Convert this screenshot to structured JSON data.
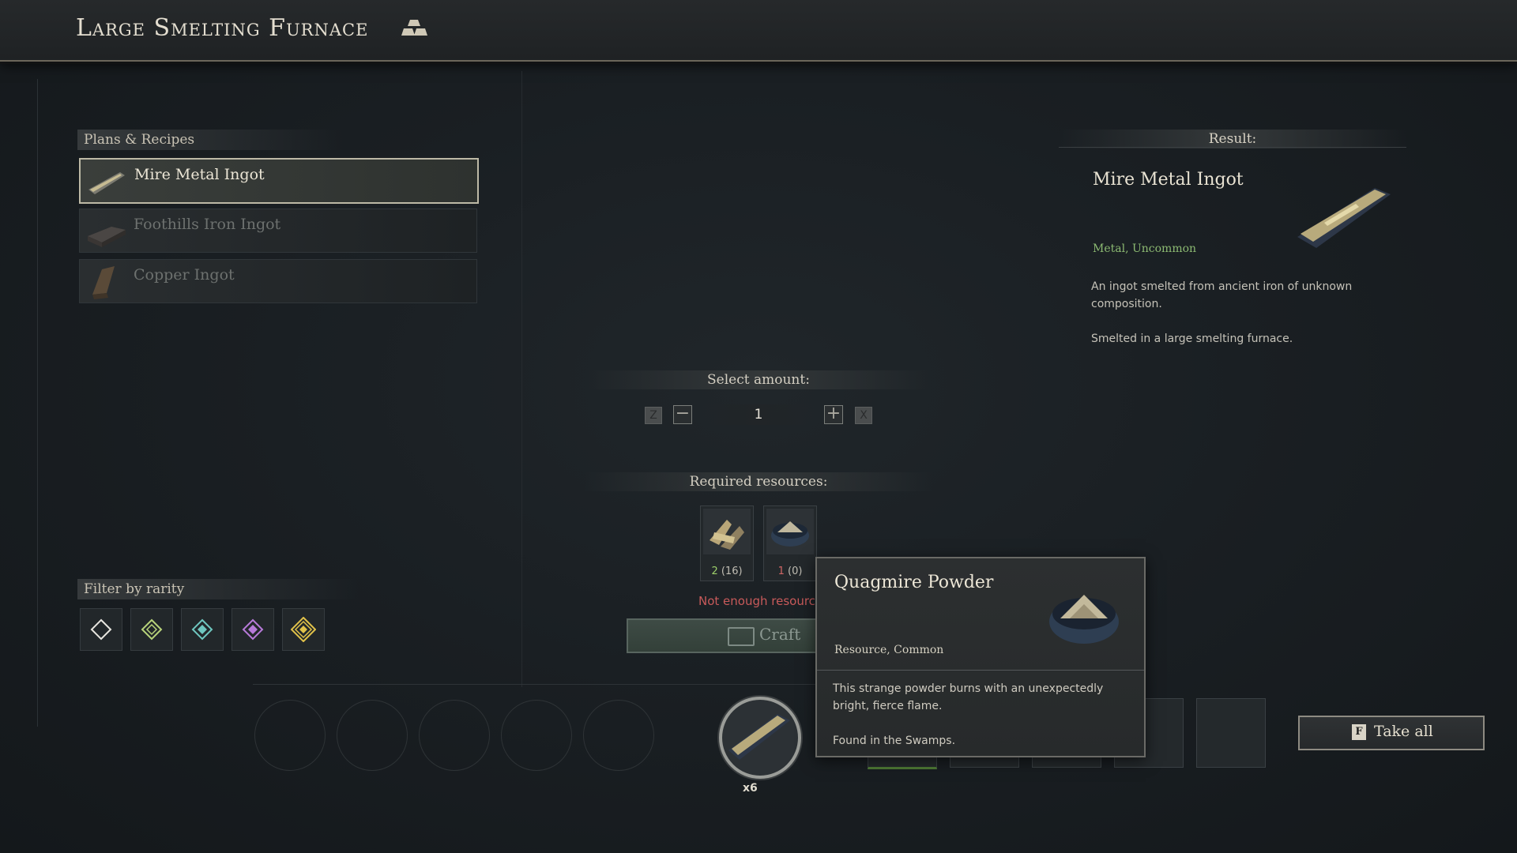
{
  "header": {
    "title": "Large Smelting Furnace",
    "icon": "ingot-stack-icon"
  },
  "recipes": {
    "label": "Plans & Recipes",
    "items": [
      {
        "label": "Mire Metal Ingot",
        "selected": true
      },
      {
        "label": "Foothills Iron Ingot",
        "selected": false
      },
      {
        "label": "Copper Ingot",
        "selected": false
      }
    ]
  },
  "filter": {
    "label": "Filter by rarity",
    "options": [
      {
        "name": "common",
        "color": "#e8e6e0"
      },
      {
        "name": "uncommon",
        "color": "#b7d37a"
      },
      {
        "name": "rare",
        "color": "#6fc7c0"
      },
      {
        "name": "epic",
        "color": "#b77ad9"
      },
      {
        "name": "legendary",
        "color": "#e1c24a"
      }
    ]
  },
  "amount": {
    "label": "Select amount:",
    "value": "1",
    "key_decrease": "Z",
    "key_increase": "X",
    "minus": "−",
    "plus": "+"
  },
  "resources": {
    "label": "Required resources:",
    "items": [
      {
        "have": "2",
        "total": "(16)",
        "have_color": "#9ccf6a"
      },
      {
        "have": "1",
        "total": "(0)",
        "have_color": "#d06666"
      }
    ],
    "warning": "Not enough resource"
  },
  "craft": {
    "label": "Craft"
  },
  "result": {
    "heading": "Result:",
    "name": "Mire Metal Ingot",
    "type": "Metal, Uncommon",
    "desc1": "An ingot smelted from ancient iron of unknown composition.",
    "desc2": "Smelted in a large smelting furnace."
  },
  "queue": {
    "count": "x6"
  },
  "take_all": {
    "key": "F",
    "label": "Take all"
  },
  "tooltip": {
    "name": "Quagmire Powder",
    "type": "Resource, Common",
    "desc1": "This strange powder burns with an unexpectedly bright, fierce flame.",
    "desc2": "Found in the Swamps."
  }
}
